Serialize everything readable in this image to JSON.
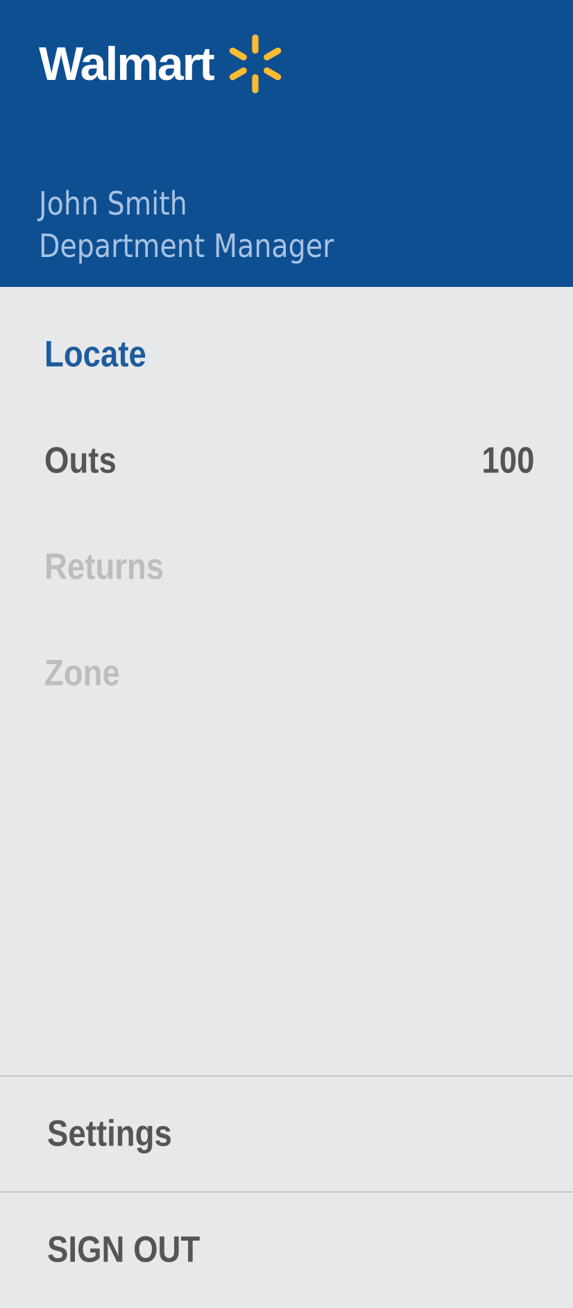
{
  "header": {
    "logo_text": "Walmart",
    "logo_icon": "walmart-spark-icon",
    "user_name": "John Smith",
    "user_role": "Department Manager"
  },
  "menu": {
    "items": [
      {
        "label": "Locate",
        "state": "active"
      },
      {
        "label": "Outs",
        "count": "100",
        "state": "normal"
      },
      {
        "label": "Returns",
        "state": "disabled"
      },
      {
        "label": "Zone",
        "state": "disabled"
      }
    ]
  },
  "footer": {
    "settings_label": "Settings",
    "sign_out_label": "SIGN OUT"
  },
  "colors": {
    "header_bg": "#0e4f92",
    "spark": "#fdbb30",
    "active": "#1d5c9c",
    "text": "#555555",
    "disabled": "#bcbdbf",
    "panel_bg": "#e7e8ea"
  }
}
